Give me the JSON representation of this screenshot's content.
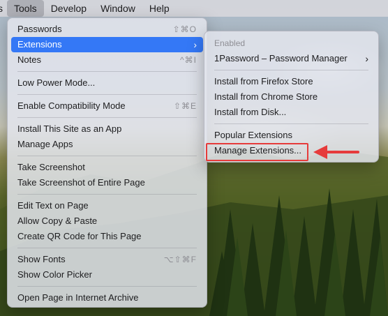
{
  "menubar": {
    "items": [
      {
        "label": "s"
      },
      {
        "label": "Tools"
      },
      {
        "label": "Develop"
      },
      {
        "label": "Window"
      },
      {
        "label": "Help"
      }
    ]
  },
  "tools_menu": {
    "passwords": {
      "label": "Passwords",
      "shortcut": "⇧⌘O"
    },
    "extensions": {
      "label": "Extensions",
      "chevron": "›"
    },
    "notes": {
      "label": "Notes",
      "shortcut": "^⌘I"
    },
    "low_power": {
      "label": "Low Power Mode..."
    },
    "compat": {
      "label": "Enable Compatibility Mode",
      "shortcut": "⇧⌘E"
    },
    "install_app": {
      "label": "Install This Site as an App"
    },
    "manage_apps": {
      "label": "Manage Apps"
    },
    "screenshot": {
      "label": "Take Screenshot"
    },
    "screenshot_full": {
      "label": "Take Screenshot of Entire Page"
    },
    "edit_text": {
      "label": "Edit Text on Page"
    },
    "allow_copy": {
      "label": "Allow Copy & Paste"
    },
    "qr_code": {
      "label": "Create QR Code for This Page"
    },
    "show_fonts": {
      "label": "Show Fonts",
      "shortcut": "⌥⇧⌘F"
    },
    "color_picker": {
      "label": "Show Color Picker"
    },
    "archive": {
      "label": "Open Page in Internet Archive"
    }
  },
  "extensions_submenu": {
    "header": "Enabled",
    "onepassword": {
      "label": "1Password – Password Manager",
      "chevron": "›"
    },
    "firefox_store": {
      "label": "Install from Firefox Store"
    },
    "chrome_store": {
      "label": "Install from Chrome Store"
    },
    "disk": {
      "label": "Install from Disk..."
    },
    "popular": {
      "label": "Popular Extensions"
    },
    "manage": {
      "label": "Manage Extensions..."
    }
  },
  "colors": {
    "highlight": "#3478f6",
    "annotation": "#e63b3b"
  }
}
